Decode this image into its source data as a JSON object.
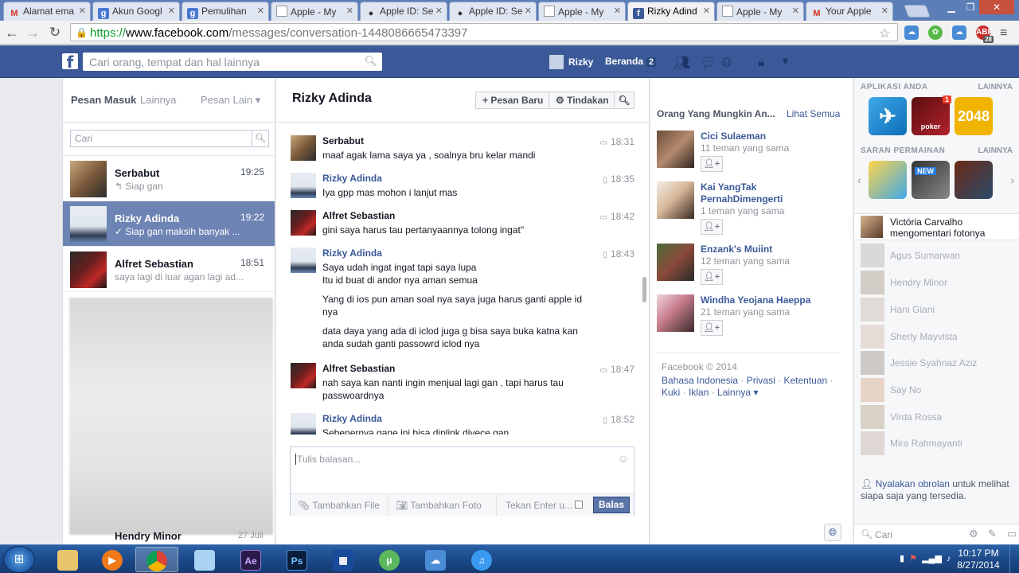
{
  "browser": {
    "tabs": [
      {
        "title": "Alamat ema",
        "favicon": "gmail-icon"
      },
      {
        "title": "Akun Googl",
        "favicon": "google-icon"
      },
      {
        "title": "Pemulihan",
        "favicon": "google-icon"
      },
      {
        "title": "Apple - My",
        "favicon": "doc-icon"
      },
      {
        "title": "Apple ID: Se",
        "favicon": "apple-icon"
      },
      {
        "title": "Apple ID: Se",
        "favicon": "apple-icon"
      },
      {
        "title": "Apple - My",
        "favicon": "doc-icon"
      },
      {
        "title": "Rizky Adind",
        "favicon": "facebook-icon"
      },
      {
        "title": "Apple - My",
        "favicon": "doc-icon"
      },
      {
        "title": "Your Apple",
        "favicon": "gmail-icon"
      }
    ],
    "url": {
      "scheme": "https://",
      "host": "www.facebook.com",
      "path": "/messages/conversation-1448086665473397"
    },
    "abp_badge": "28"
  },
  "fb_header": {
    "search_placeholder": "Cari orang, tempat dan hal lainnya",
    "profile_name": "Rizky",
    "home_label": "Beranda",
    "home_count": "2"
  },
  "inbox": {
    "tab_inbox": "Pesan Masuk",
    "tab_other": "Lainnya",
    "tab_filtered": "Pesan Lain",
    "search_placeholder": "Cari",
    "threads": [
      {
        "name": "Serbabut",
        "time": "19:25",
        "snippet": "↰ Siap gan"
      },
      {
        "name": "Rizky Adinda",
        "time": "19:22",
        "snippet": "✓ Siap gan maksih banyak ..."
      },
      {
        "name": "Alfret Sebastian",
        "time": "18:51",
        "snippet": "saya lagi di luar agan lagi ad..."
      }
    ],
    "partial_thread": {
      "name": "Hendry Minor",
      "time": "27 Juli"
    }
  },
  "conversation": {
    "title": "Rizky Adinda",
    "new_message_label": "Pesan Baru",
    "actions_label": "Tindakan",
    "messages": [
      {
        "sender": "Serbabut",
        "time": "18:31",
        "body": [
          "maaf agak  lama saya ya , soalnya bru kelar mandi"
        ]
      },
      {
        "sender": "Rizky Adinda",
        "time": "18:35",
        "body": [
          "Iya gpp mas mohon i lanjut mas"
        ]
      },
      {
        "sender": "Alfret Sebastian",
        "time": "18:42",
        "body": [
          "gini saya harus tau pertanyaannya tolong ingat\""
        ]
      },
      {
        "sender": "Rizky Adinda",
        "time": "18:43",
        "body": [
          "Saya udah ingat ingat tapi saya lupa\nItu id buat di andor nya aman semua",
          "Yang di ios pun aman soal nya saya juga harus ganti apple id nya",
          "data daya yang ada di iclod juga g bisa saya buka katna kan anda sudah ganti passowrd iclod nya"
        ]
      },
      {
        "sender": "Alfret Sebastian",
        "time": "18:47",
        "body": [
          "nah saya kan nanti ingin menjual lagi  gan , tapi harus tau passwoardnya"
        ]
      },
      {
        "sender": "Rizky Adinda",
        "time": "18:52",
        "body": [
          "Sebenernya gane ini bisa diplink divece gan"
        ]
      }
    ],
    "reply_placeholder": "Tulis balasan...",
    "add_file_label": "Tambahkan File",
    "add_photo_label": "Tambahkan Foto",
    "enter_toggle_label": "Tekan Enter u...",
    "reply_button_label": "Balas"
  },
  "pymk": {
    "header": "Orang Yang Mungkin An...",
    "see_all": "Lihat Semua",
    "people": [
      {
        "name": "Cici Sulaeman",
        "mutual": "11 teman yang sama"
      },
      {
        "name": "Kai YangTak PernahDimengerti",
        "mutual": "1 teman yang sama"
      },
      {
        "name": "Enzank's Muiint",
        "mutual": "12 teman yang sama"
      },
      {
        "name": "Windha Yeojana Haeppa",
        "mutual": "21 teman yang sama"
      }
    ]
  },
  "footer": {
    "copyright": "Facebook © 2014",
    "links": [
      "Bahasa Indonesia",
      "Privasi",
      "Ketentuan",
      "Kuki",
      "Iklan",
      "Lainnya ▾"
    ]
  },
  "sidebar": {
    "apps_header": "APLIKASI ANDA",
    "apps_more": "LAINNYA",
    "apps": [
      {
        "label": "",
        "badge": ""
      },
      {
        "label": "poker",
        "badge": "1"
      },
      {
        "label": "2048",
        "badge": ""
      }
    ],
    "games_header": "SARAN PERMAINAN",
    "games_more": "LAINNYA",
    "games_new_badge": "NEW",
    "ticker": {
      "name": "Victória Carvalho",
      "action": "mengomentari fotonya"
    },
    "chat_friends": [
      "Agus Sumarwan",
      "Hendry Minor",
      "Hani Giani",
      "Sherly Mayvista",
      "Jessie Syahnaz Aziz",
      "Say No",
      "Virda Rossa",
      "Mira Rahmayanti"
    ],
    "chat_turn_on_link": "Nyalakan obrolan",
    "chat_turn_on_text": " untuk melihat siapa saja yang tersedia.",
    "chat_search_placeholder": "Cari"
  },
  "taskbar": {
    "apps": [
      "explorer",
      "media-player",
      "chrome",
      "notepad",
      "after-effects",
      "photoshop",
      "start-menu-app",
      "utorrent",
      "cloud",
      "itunes"
    ],
    "ae_label": "Ae",
    "ps_label": "Ps",
    "time": "10:17 PM",
    "date": "8/27/2014"
  },
  "colors": {
    "fb_blue": "#3b5998",
    "selected_thread": "#6d84b4",
    "taskbar": "#1c4a8a"
  }
}
